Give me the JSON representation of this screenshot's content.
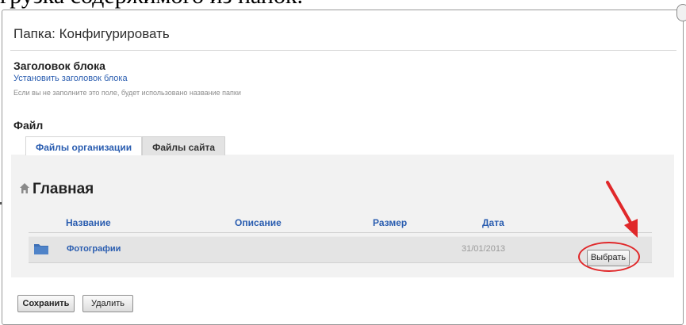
{
  "doc_fragment": "грузка содержимого из папок.",
  "dialog": {
    "title": "Папка: Конфигурировать",
    "block_title_label": "Заголовок блока",
    "set_block_title_link": "Установить заголовок блока",
    "help_text": "Если вы не заполните это поле, будет использовано название папки",
    "file_label": "Файл"
  },
  "tabs": [
    {
      "label": "Файлы организации",
      "active": true
    },
    {
      "label": "Файлы сайта",
      "active": false
    }
  ],
  "browser": {
    "heading": "Главная",
    "columns": [
      "Название",
      "Описание",
      "Размер",
      "Дата"
    ],
    "rows": [
      {
        "name": "Фотографии",
        "description": "",
        "size": "",
        "date": "31/01/2013",
        "action_label": "Выбрать"
      }
    ]
  },
  "footer": {
    "save_label": "Сохранить",
    "delete_label": "Удалить"
  },
  "icons": {
    "home": "home-icon",
    "folder": "folder-icon",
    "annotation_arrow": "red-arrow"
  },
  "colors": {
    "link": "#2a5db0",
    "annotation": "#e0282a",
    "panel": "#f2f2f2"
  }
}
